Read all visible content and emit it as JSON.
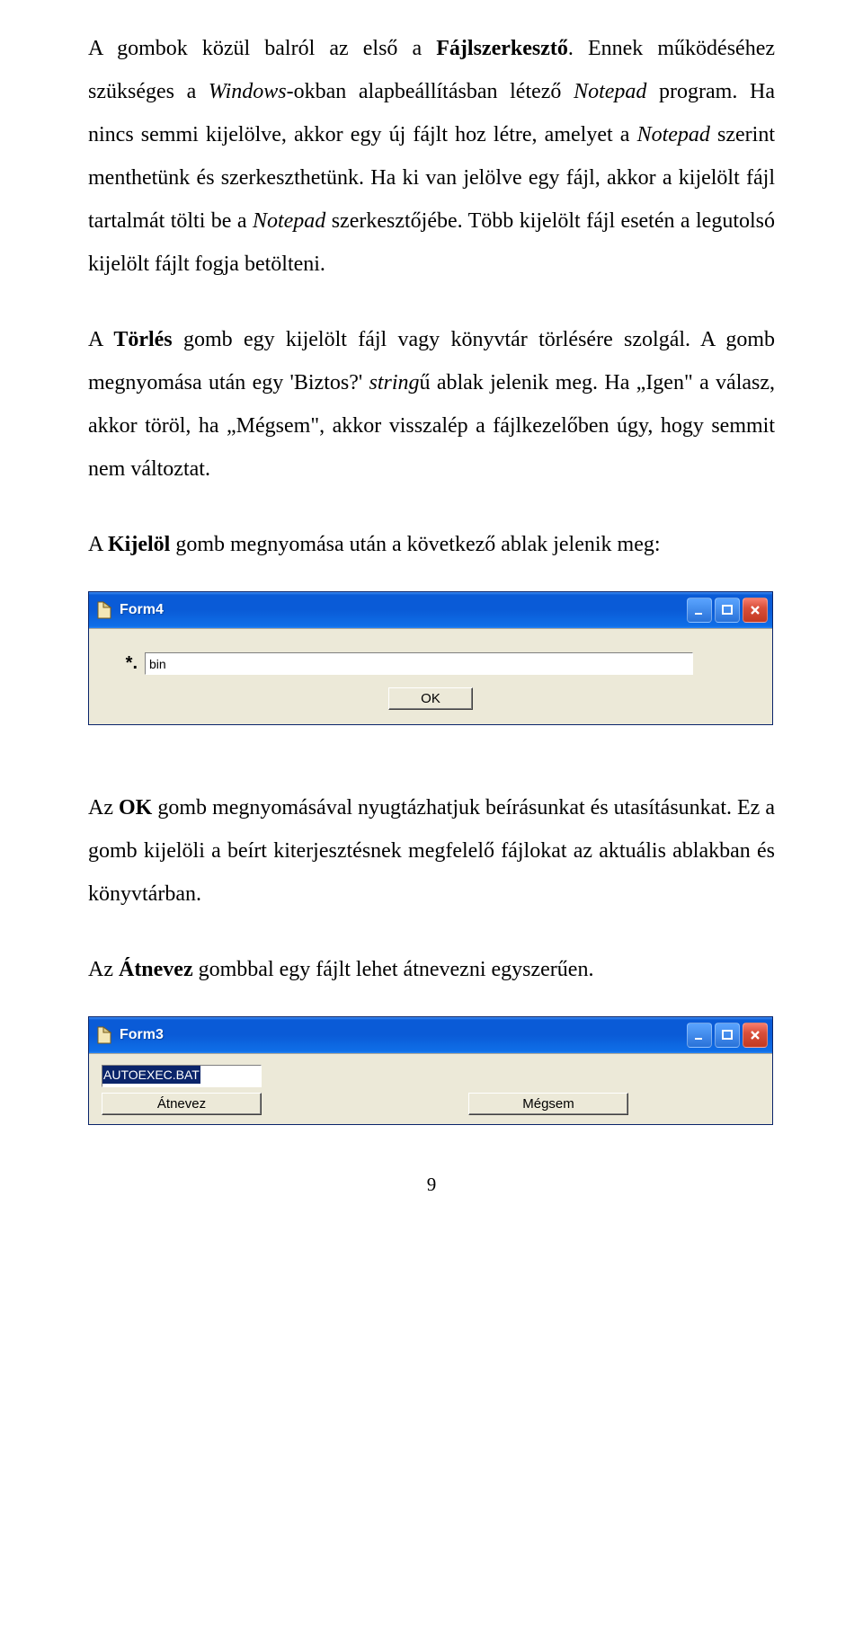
{
  "para1": {
    "a": "A gombok közül balról az első a ",
    "b_bold": "Fájlszerkesztő",
    "c": ". Ennek működéséhez szükséges a ",
    "d_italic": "Windows-",
    "e": "okban alapbeállításban létező ",
    "f_italic": "Notepad",
    "g": " program. Ha nincs semmi kijelölve, akkor egy új fájlt hoz létre, amelyet a ",
    "h_italic": "Notepad",
    "i": " szerint menthetünk és szerkeszthetünk. Ha ki van jelölve egy fájl, akkor a kijelölt fájl tartalmát tölti be a ",
    "j_italic": "Notepad",
    "k": " szerkesztőjébe. Több kijelölt fájl esetén a legutolsó kijelölt fájlt fogja betölteni."
  },
  "para2": {
    "a": "A ",
    "b_bold": "Törlés",
    "c": " gomb egy kijelölt fájl vagy könyvtár törlésére szolgál. A gomb megnyomása után egy 'Biztos?' ",
    "d_italic": "string",
    "e": "ű ablak jelenik meg. Ha „Igen\" a válasz, akkor töröl, ha „Mégsem\", akkor visszalép a fájlkezelőben úgy, hogy semmit nem változtat."
  },
  "para3": {
    "a": "A ",
    "b_bold": "Kijelöl",
    "c": " gomb megnyomása után a következő ablak jelenik meg:"
  },
  "form4": {
    "title": "Form4",
    "star": "*.",
    "input_value": "bin",
    "ok_label": "OK"
  },
  "para4": {
    "a": "Az ",
    "b_bold": "OK",
    "c": " gomb megnyomásával nyugtázhatjuk beírásunkat és utasításunkat. Ez a gomb kijelöli a beírt kiterjesztésnek megfelelő fájlokat az aktuális ablakban és könyvtárban."
  },
  "para5": {
    "a": "Az ",
    "b_bold": "Átnevez",
    "c": " gombbal egy fájlt lehet átnevezni egyszerűen."
  },
  "form3": {
    "title": "Form3",
    "input_value": "AUTOEXEC.BAT",
    "rename_label": "Átnevez",
    "cancel_label": "Mégsem"
  },
  "page_number": "9"
}
